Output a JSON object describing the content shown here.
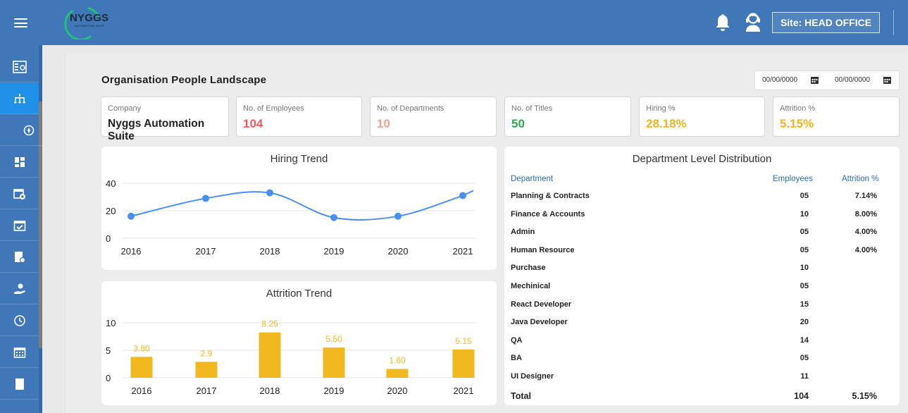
{
  "brand": {
    "name": "NYGGS",
    "tagline": "AUTOMATION SUITE"
  },
  "header": {
    "site_label": "Site: HEAD OFFICE"
  },
  "sidebar": {
    "items": [
      {
        "icon": "dashboard-panel-icon"
      },
      {
        "icon": "org-chart-icon",
        "active": true
      },
      {
        "icon": "compass-icon"
      },
      {
        "icon": "grid-icon"
      },
      {
        "icon": "calendar-add-icon"
      },
      {
        "icon": "calendar-check-icon"
      },
      {
        "icon": "document-badge-icon"
      },
      {
        "icon": "hand-user-icon"
      },
      {
        "icon": "timer-icon"
      },
      {
        "icon": "calendar-grid-icon"
      },
      {
        "icon": "page-icon"
      }
    ]
  },
  "page": {
    "title": "Organisation People Landscape",
    "date_from": "00/00/0000",
    "date_to": "00/00/0000"
  },
  "kpis": [
    {
      "label": "Company",
      "value": "Nyggs Automation Suite",
      "color": "#222222"
    },
    {
      "label": "No. of Employees",
      "value": "104",
      "color": "#ee5a5a"
    },
    {
      "label": "No. of Departments",
      "value": "10",
      "color": "#f4a09a"
    },
    {
      "label": "No. of Titles",
      "value": "50",
      "color": "#2fa84f"
    },
    {
      "label": "Hiring %",
      "value": "28.18%",
      "color": "#f2b51c"
    },
    {
      "label": "Attrition %",
      "value": "5.15%",
      "color": "#f2b51c"
    }
  ],
  "chart_data": [
    {
      "type": "line",
      "title": "Hiring Trend",
      "categories": [
        "2016",
        "2017",
        "2018",
        "2019",
        "2020",
        "2021"
      ],
      "values": [
        16,
        29,
        33,
        15,
        16,
        31
      ],
      "yticks": [
        "0",
        "20",
        "40"
      ],
      "ylim": [
        0,
        40
      ],
      "color": "#4a8ff0",
      "grid": true
    },
    {
      "type": "bar",
      "title": "Attrition Trend",
      "categories": [
        "2016",
        "2017",
        "2018",
        "2019",
        "2020",
        "2021"
      ],
      "values": [
        3.8,
        2.9,
        8.25,
        5.5,
        1.6,
        5.15
      ],
      "data_labels": [
        "3.80",
        "2.9",
        "8.25",
        "5.50",
        "1.60",
        "5.15"
      ],
      "yticks": [
        "0",
        "5",
        "10"
      ],
      "ylim": [
        0,
        10
      ],
      "color": "#f2b81f",
      "grid": true
    }
  ],
  "dept": {
    "title": "Department Level Distribution",
    "headers": [
      "Department",
      "Employees",
      "Attrition %"
    ],
    "rows": [
      [
        "Planning & Contracts",
        "05",
        "7.14%"
      ],
      [
        "Finance & Accounts",
        "10",
        "8.00%"
      ],
      [
        "Admin",
        "05",
        "4.00%"
      ],
      [
        "Human Resource",
        "05",
        "4.00%"
      ],
      [
        "Purchase",
        "10",
        ""
      ],
      [
        "Mechinical",
        "05",
        ""
      ],
      [
        "React Developer",
        "15",
        ""
      ],
      [
        "Java Developer",
        "20",
        ""
      ],
      [
        "QA",
        "14",
        ""
      ],
      [
        "BA",
        "05",
        ""
      ],
      [
        "UI Designer",
        "11",
        ""
      ]
    ],
    "total": [
      "Total",
      "104",
      "5.15%"
    ]
  }
}
